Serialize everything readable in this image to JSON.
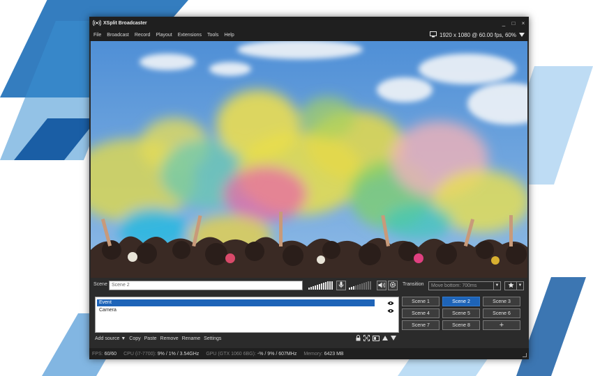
{
  "app": {
    "title": "XSplit Broadcaster",
    "window_controls": {
      "minimize": "_",
      "maximize": "□",
      "close": "×"
    }
  },
  "menu": [
    "File",
    "Broadcast",
    "Record",
    "Playout",
    "Extensions",
    "Tools",
    "Help"
  ],
  "resolution": {
    "label": "1920 x 1080 @ 60.00 fps, 60%",
    "icon": "monitor-icon"
  },
  "scene": {
    "label": "Scene",
    "name": "Scene 2"
  },
  "transition": {
    "label": "Transition",
    "value": "Move bottom: 700ms"
  },
  "sources": [
    {
      "name": "Event",
      "selected": true,
      "visible": true
    },
    {
      "name": "Camera",
      "selected": false,
      "visible": true
    }
  ],
  "source_toolbar": {
    "add_source": "Add source ▼",
    "copy": "Copy",
    "paste": "Paste",
    "remove": "Remove",
    "rename": "Rename",
    "settings": "Settings"
  },
  "scenes": [
    {
      "label": "Scene 1",
      "active": false
    },
    {
      "label": "Scene 2",
      "active": true
    },
    {
      "label": "Scene 3",
      "active": false
    },
    {
      "label": "Scene 4",
      "active": false
    },
    {
      "label": "Scene 5",
      "active": false
    },
    {
      "label": "Scene 6",
      "active": false
    },
    {
      "label": "Scene 7",
      "active": false
    },
    {
      "label": "Scene 8",
      "active": false
    },
    {
      "label": "+",
      "active": false
    }
  ],
  "status": {
    "fps_label": "FPS:",
    "fps_value": "60/60",
    "cpu_label": "CPU (i7-7700):",
    "cpu_value": "9% / 1% / 3.54GHz",
    "gpu_label": "GPU (GTX 1060 6BG):",
    "gpu_value": "-% / 9% / 607MHz",
    "memory_label": "Memory:",
    "memory_value": "6423 MB"
  },
  "colors": {
    "accent": "#1e64b8",
    "window_bg": "#2b2b2b",
    "bar_bg": "#1f1f1f"
  }
}
